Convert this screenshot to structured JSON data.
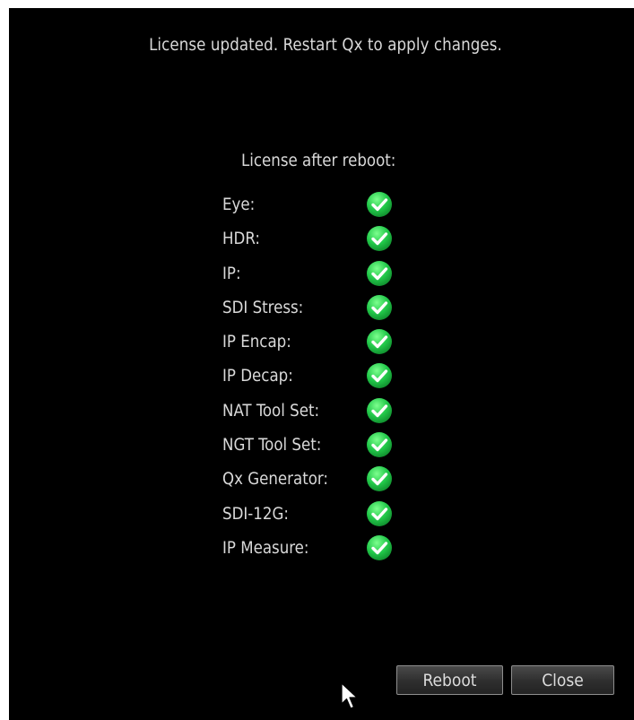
{
  "dialog": {
    "message": "License updated. Restart Qx to apply changes.",
    "subtitle": "License after reboot:",
    "items": [
      {
        "label": "Eye:",
        "enabled": true
      },
      {
        "label": "HDR:",
        "enabled": true
      },
      {
        "label": "IP:",
        "enabled": true
      },
      {
        "label": "SDI Stress:",
        "enabled": true
      },
      {
        "label": "IP Encap:",
        "enabled": true
      },
      {
        "label": "IP Decap:",
        "enabled": true
      },
      {
        "label": "NAT Tool Set:",
        "enabled": true
      },
      {
        "label": "NGT Tool Set:",
        "enabled": true
      },
      {
        "label": "Qx Generator:",
        "enabled": true
      },
      {
        "label": "SDI-12G:",
        "enabled": true
      },
      {
        "label": "IP Measure:",
        "enabled": true
      }
    ],
    "buttons": {
      "reboot": "Reboot",
      "close": "Close"
    }
  },
  "icons": {
    "check": "check-circle-icon",
    "cursor": "mouse-pointer-icon"
  },
  "colors": {
    "background": "#000000",
    "text": "#d9d9d9",
    "check_green": "#22c94a"
  }
}
